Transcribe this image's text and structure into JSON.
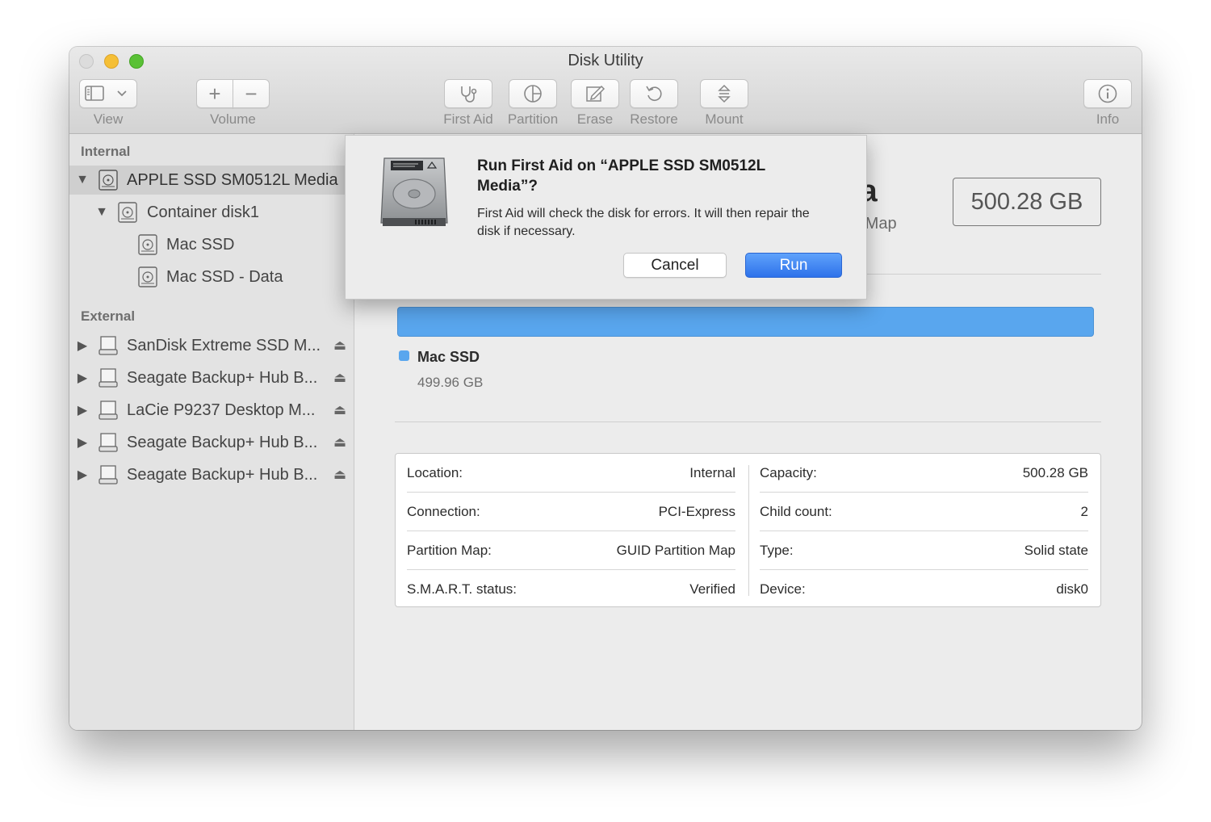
{
  "window": {
    "title": "Disk Utility"
  },
  "toolbar": {
    "view_label": "View",
    "volume_label": "Volume",
    "first_aid_label": "First Aid",
    "partition_label": "Partition",
    "erase_label": "Erase",
    "restore_label": "Restore",
    "mount_label": "Mount",
    "info_label": "Info",
    "add_symbol": "+",
    "remove_symbol": "−"
  },
  "sidebar": {
    "internal_header": "Internal",
    "external_header": "External",
    "internal_items": [
      {
        "label": "APPLE SSD SM0512L Media",
        "icon": "internal-disk-icon",
        "expanded": true,
        "selected": true
      },
      {
        "label": "Container disk1",
        "icon": "container-disk-icon",
        "expanded": true
      },
      {
        "label": "Mac SSD",
        "icon": "volume-disk-icon"
      },
      {
        "label": "Mac SSD - Data",
        "icon": "volume-disk-icon"
      }
    ],
    "external_items": [
      {
        "label": "SanDisk Extreme SSD M...",
        "icon": "external-disk-icon"
      },
      {
        "label": "Seagate Backup+ Hub B...",
        "icon": "external-disk-icon"
      },
      {
        "label": "LaCie P9237 Desktop M...",
        "icon": "external-disk-icon"
      },
      {
        "label": "Seagate Backup+ Hub B...",
        "icon": "external-disk-icon"
      },
      {
        "label": "Seagate Backup+ Hub B...",
        "icon": "external-disk-icon"
      }
    ]
  },
  "main": {
    "title_fragment": "ia",
    "subtitle_fragment": "n Map",
    "capacity": "500.28 GB",
    "legend": {
      "name": "Mac SSD",
      "size": "499.96 GB",
      "color": "#59a6ee"
    },
    "info": {
      "left": [
        {
          "label": "Location:",
          "value": "Internal"
        },
        {
          "label": "Connection:",
          "value": "PCI-Express"
        },
        {
          "label": "Partition Map:",
          "value": "GUID Partition Map"
        },
        {
          "label": "S.M.A.R.T. status:",
          "value": "Verified"
        }
      ],
      "right": [
        {
          "label": "Capacity:",
          "value": "500.28 GB"
        },
        {
          "label": "Child count:",
          "value": "2"
        },
        {
          "label": "Type:",
          "value": "Solid state"
        },
        {
          "label": "Device:",
          "value": "disk0"
        }
      ]
    }
  },
  "dialog": {
    "title": "Run First Aid on “APPLE SSD SM0512L Media”?",
    "message": "First Aid will check the disk for errors. It will then repair the disk if necessary.",
    "cancel_label": "Cancel",
    "run_label": "Run",
    "accent": "#2e72ea"
  }
}
